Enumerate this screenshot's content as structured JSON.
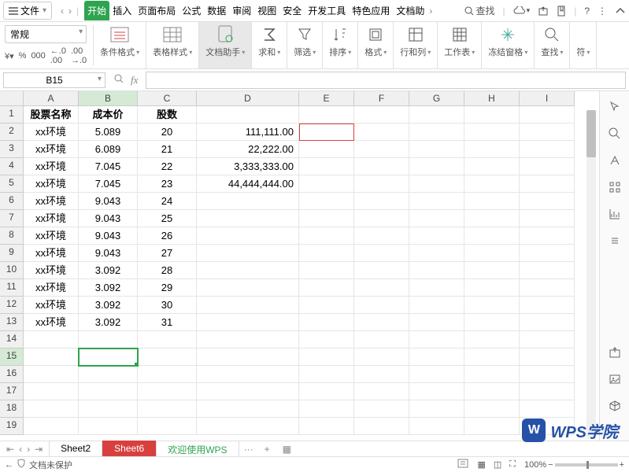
{
  "menubar": {
    "file": "文件",
    "search": "查找",
    "tabs": [
      "开始",
      "插入",
      "页面布局",
      "公式",
      "数据",
      "审阅",
      "视图",
      "安全",
      "开发工具",
      "特色应用",
      "文档助"
    ],
    "active_tab_index": 0
  },
  "ribbon": {
    "format_dropdown": "常规",
    "currency": "¥",
    "percent": "%",
    "thousand": "000",
    "inc_dec": ".0",
    "inc_dec2": ".00",
    "groups": [
      {
        "label": "条件格式",
        "icon": "cond"
      },
      {
        "label": "表格样式",
        "icon": "table"
      },
      {
        "label": "文档助手",
        "icon": "doc",
        "active": true
      },
      {
        "label": "求和",
        "icon": "sum"
      },
      {
        "label": "筛选",
        "icon": "filter"
      },
      {
        "label": "排序",
        "icon": "sort"
      },
      {
        "label": "格式",
        "icon": "format"
      },
      {
        "label": "行和列",
        "icon": "rowcol"
      },
      {
        "label": "工作表",
        "icon": "sheet"
      },
      {
        "label": "冻结窗格",
        "icon": "freeze"
      },
      {
        "label": "查找",
        "icon": "search"
      },
      {
        "label": "符",
        "icon": "more"
      }
    ]
  },
  "formula": {
    "name_box": "B15",
    "value": ""
  },
  "sheet": {
    "cols": [
      "A",
      "B",
      "C",
      "D",
      "E",
      "F",
      "G",
      "H",
      "I"
    ],
    "rows": [
      {
        "r": 1,
        "A": "股票名称",
        "B": "成本价",
        "C": "股数",
        "D": "",
        "E": ""
      },
      {
        "r": 2,
        "A": "xx环境",
        "B": "5.089",
        "C": "20",
        "D": "111,111.00",
        "E": ""
      },
      {
        "r": 3,
        "A": "xx环境",
        "B": "6.089",
        "C": "21",
        "D": "22,222.00",
        "E": ""
      },
      {
        "r": 4,
        "A": "xx环境",
        "B": "7.045",
        "C": "22",
        "D": "3,333,333.00",
        "E": ""
      },
      {
        "r": 5,
        "A": "xx环境",
        "B": "7.045",
        "C": "23",
        "D": "44,444,444.00",
        "E": ""
      },
      {
        "r": 6,
        "A": "xx环境",
        "B": "9.043",
        "C": "24",
        "D": "",
        "E": ""
      },
      {
        "r": 7,
        "A": "xx环境",
        "B": "9.043",
        "C": "25",
        "D": "",
        "E": ""
      },
      {
        "r": 8,
        "A": "xx环境",
        "B": "9.043",
        "C": "26",
        "D": "",
        "E": ""
      },
      {
        "r": 9,
        "A": "xx环境",
        "B": "9.043",
        "C": "27",
        "D": "",
        "E": ""
      },
      {
        "r": 10,
        "A": "xx环境",
        "B": "3.092",
        "C": "28",
        "D": "",
        "E": ""
      },
      {
        "r": 11,
        "A": "xx环境",
        "B": "3.092",
        "C": "29",
        "D": "",
        "E": ""
      },
      {
        "r": 12,
        "A": "xx环境",
        "B": "3.092",
        "C": "30",
        "D": "",
        "E": ""
      },
      {
        "r": 13,
        "A": "xx环境",
        "B": "3.092",
        "C": "31",
        "D": "",
        "E": ""
      },
      {
        "r": 14,
        "A": "",
        "B": "",
        "C": "",
        "D": "",
        "E": ""
      },
      {
        "r": 15,
        "A": "",
        "B": "",
        "C": "",
        "D": "",
        "E": ""
      },
      {
        "r": 16,
        "A": "",
        "B": "",
        "C": "",
        "D": "",
        "E": ""
      },
      {
        "r": 17,
        "A": "",
        "B": "",
        "C": "",
        "D": "",
        "E": ""
      },
      {
        "r": 18,
        "A": "",
        "B": "",
        "C": "",
        "D": "",
        "E": ""
      },
      {
        "r": 19,
        "A": "",
        "B": "",
        "C": "",
        "D": "",
        "E": ""
      }
    ],
    "selected": {
      "row": 15,
      "col": "B"
    },
    "boxed": {
      "row": 2,
      "col": "E"
    }
  },
  "sheet_tabs": {
    "tabs": [
      {
        "label": "Sheet2",
        "active": false
      },
      {
        "label": "Sheet6",
        "active": true
      },
      {
        "label": "欢迎使用WPS",
        "active": false,
        "green": true
      }
    ],
    "more": "···"
  },
  "status": {
    "protect": "文档未保护",
    "zoom": "100%"
  },
  "watermark": "WPS学院"
}
